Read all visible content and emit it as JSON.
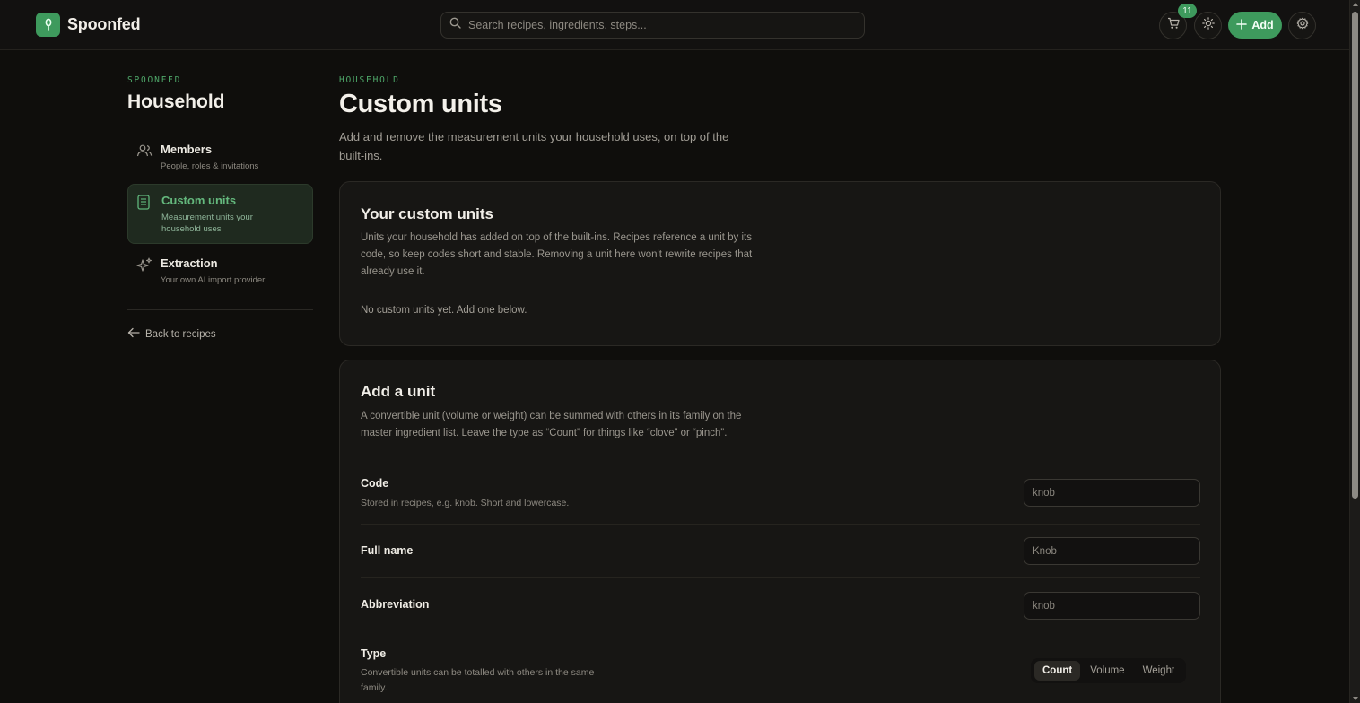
{
  "app": {
    "name": "Spoonfed",
    "search_placeholder": "Search recipes, ingredients, steps...",
    "cart_count": "11",
    "add_label": "Add"
  },
  "sidebar": {
    "eyebrow": "SPOONFED",
    "title": "Household",
    "items": [
      {
        "label": "Members",
        "sub": "People, roles & invitations",
        "icon": "users-icon"
      },
      {
        "label": "Custom units",
        "sub": "Measurement units your household uses",
        "icon": "document-icon",
        "active": true
      },
      {
        "label": "Extraction",
        "sub": "Your own AI import provider",
        "icon": "sparkle-icon"
      }
    ],
    "back_label": "Back to recipes"
  },
  "main": {
    "eyebrow": "HOUSEHOLD",
    "title": "Custom units",
    "description": "Add and remove the measurement units your household uses, on top of the built-ins."
  },
  "custom_units_card": {
    "title": "Your custom units",
    "description": "Units your household has added on top of the built-ins. Recipes reference a unit by its code, so keep codes short and stable. Removing a unit here won't rewrite recipes that already use it.",
    "empty_text": "No custom units yet. Add one below."
  },
  "add_unit_card": {
    "title": "Add a unit",
    "description": "A convertible unit (volume or weight) can be summed with others in its family on the master ingredient list. Leave the type as “Count” for things like “clove” or “pinch”.",
    "code": {
      "label": "Code",
      "help": "Stored in recipes, e.g. knob. Short and lowercase.",
      "placeholder": "knob"
    },
    "full_name": {
      "label": "Full name",
      "placeholder": "Knob"
    },
    "abbreviation": {
      "label": "Abbreviation",
      "placeholder": "knob"
    },
    "type": {
      "label": "Type",
      "help": "Convertible units can be totalled with others in the same family.",
      "options": [
        "Count",
        "Volume",
        "Weight"
      ],
      "selected": "Count"
    }
  },
  "colors": {
    "accent": "#3e9a5d",
    "background": "#0f0e0c",
    "card": "#171614"
  }
}
